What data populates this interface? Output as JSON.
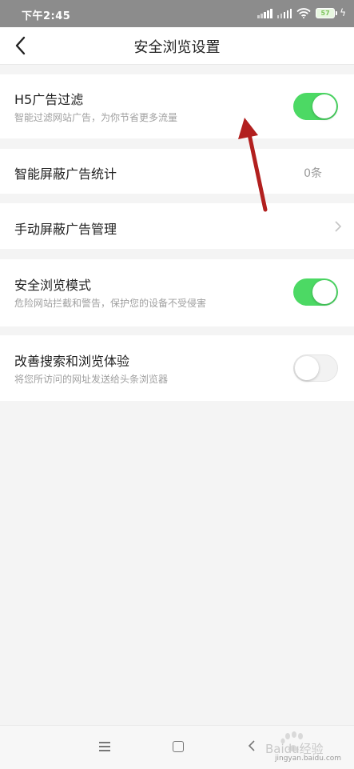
{
  "status_bar": {
    "time": "下午2:45",
    "battery": "57"
  },
  "header": {
    "title": "安全浏览设置"
  },
  "settings": {
    "h5_filter": {
      "label": "H5广告过滤",
      "desc": "智能过滤网站广告，为你节省更多流量",
      "enabled": true
    },
    "ad_stats": {
      "label": "智能屏蔽广告统计",
      "value": "0条"
    },
    "manual_block": {
      "label": "手动屏蔽广告管理"
    },
    "safe_mode": {
      "label": "安全浏览模式",
      "desc": "危险网站拦截和警告，保护您的设备不受侵害",
      "enabled": true
    },
    "improve": {
      "label": "改善搜索和浏览体验",
      "desc": "将您所访问的网址发送给头条浏览器",
      "enabled": false
    }
  },
  "watermark": {
    "brand": "Baidu经验",
    "url": "jingyan.baidu.com"
  },
  "colors": {
    "toggle_on": "#4cd964",
    "toggle_off": "#f2f2f2",
    "annotation_arrow": "#b2201f",
    "status_bar": "#8c8c8c"
  }
}
